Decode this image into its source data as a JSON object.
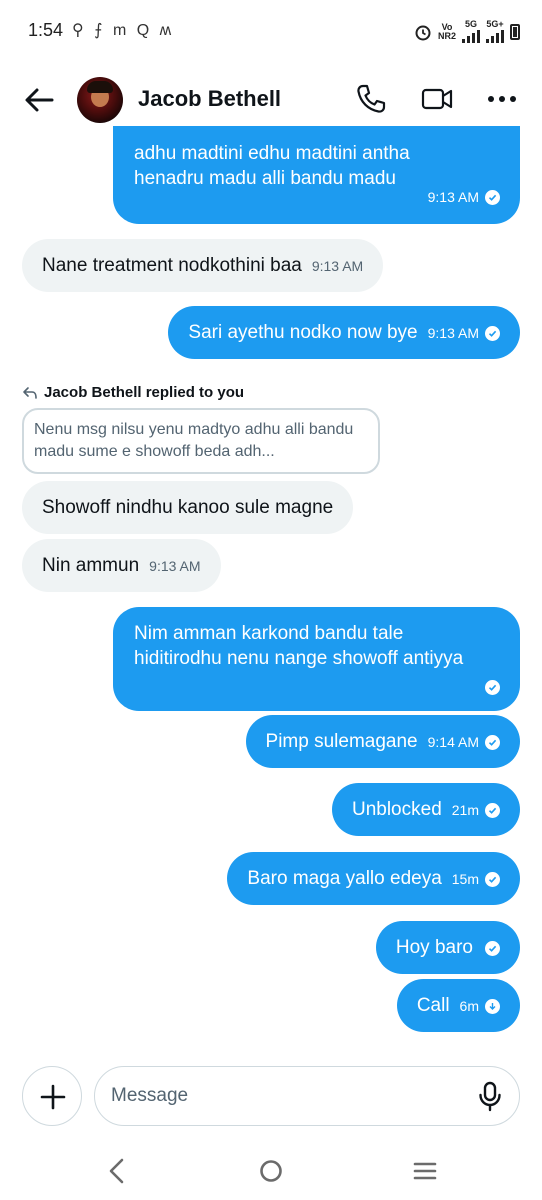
{
  "status_bar": {
    "time": "1:54",
    "notification_glyphs": "⚲ ⨍ m Q ʍ",
    "net1_top": "Vo",
    "net1_bottom": "NR2",
    "net2": "5G",
    "net3": "5G+"
  },
  "header": {
    "name": "Jacob Bethell"
  },
  "messages": [
    {
      "direction": "out",
      "text": "adhu madtini edhu madtini antha henadru madu alli bandu madu",
      "time": "9:13 AM"
    },
    {
      "direction": "in",
      "text": "Nane treatment nodkothini baa",
      "time": "9:13 AM"
    },
    {
      "direction": "out",
      "text": "Sari ayethu nodko now bye",
      "time": "9:13 AM"
    },
    {
      "direction": "in",
      "text": "Showoff nindhu kanoo sule magne",
      "time": ""
    },
    {
      "direction": "in",
      "text": "Nin ammun",
      "time": "9:13 AM"
    },
    {
      "direction": "out",
      "text": "Nim amman karkond bandu tale hiditirodhu nenu nange showoff antiyya",
      "time": ""
    },
    {
      "direction": "out",
      "text": "Pimp sulemagane",
      "time": "9:14 AM"
    },
    {
      "direction": "out",
      "text": "Unblocked",
      "time": "21m"
    },
    {
      "direction": "out",
      "text": "Baro maga yallo edeya",
      "time": "15m"
    },
    {
      "direction": "out",
      "text": "Hoy baro",
      "time": ""
    },
    {
      "direction": "out",
      "text": "Call",
      "time": "6m"
    }
  ],
  "reply": {
    "label": "Jacob Bethell replied to you",
    "quoted_text": "Nenu msg nilsu yenu madtyo adhu alli bandu madu sume e showoff beda adh..."
  },
  "composer": {
    "placeholder": "Message"
  },
  "colors": {
    "outgoing_bubble": "#1d9bf0",
    "incoming_bubble": "#eff3f4",
    "text": "#0f1419",
    "secondary_text": "#536471"
  }
}
